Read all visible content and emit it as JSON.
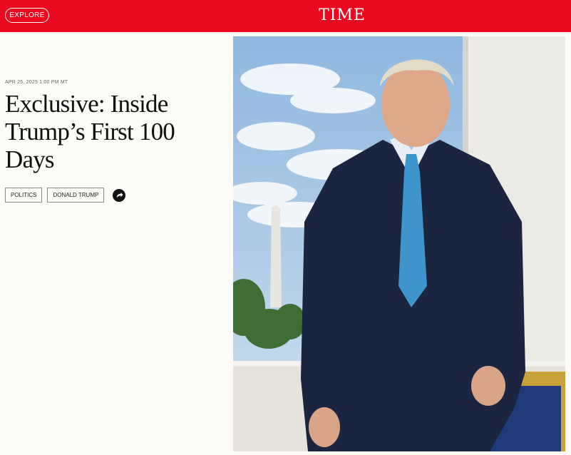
{
  "header": {
    "explore_label": "EXPLORE",
    "logo_text": "TIME",
    "brand_color": "#e90a1f"
  },
  "article": {
    "dateline": "APR 25, 2025 1:00 PM MT",
    "headline": "Exclusive: Inside Trump’s First 100 Days",
    "tags": [
      "POLITICS",
      "DONALD TRUMP"
    ],
    "share_icon": "share-arrow-icon"
  },
  "hero_image": {
    "subject": "portrait-photo"
  }
}
